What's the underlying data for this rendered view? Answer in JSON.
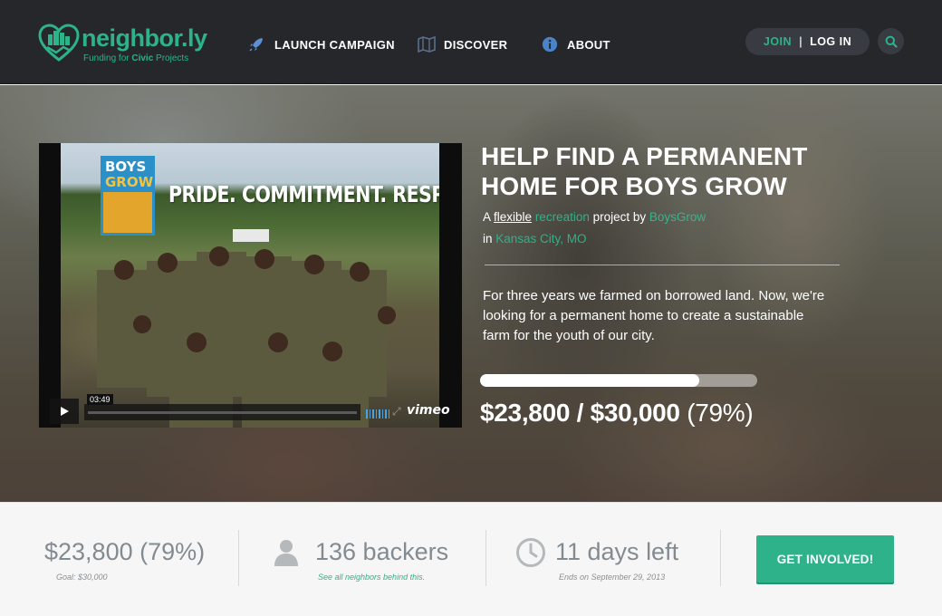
{
  "nav": {
    "logo_text": "neighbor.ly",
    "tagline_prefix": "Funding for ",
    "tagline_bold": "Civic",
    "tagline_suffix": " Projects",
    "items": [
      {
        "label": "LAUNCH CAMPAIGN",
        "icon": "rocket-icon"
      },
      {
        "label": "DISCOVER",
        "icon": "map-icon"
      },
      {
        "label": "ABOUT",
        "icon": "info-icon"
      }
    ],
    "join_label": "JOIN",
    "auth_separator": "|",
    "login_label": "LOG IN",
    "search_icon": "search-icon"
  },
  "video": {
    "badge_line1": "BOYS",
    "badge_line2": "GROW",
    "slogan": "PRIDE. COMMITMENT. RESPECT.",
    "time": "03:49",
    "provider": "vimeo"
  },
  "project": {
    "title": "HELP FIND A PERMANENT HOME FOR BOYS GROW",
    "byline_a": "A ",
    "funding_type": "flexible",
    "category": "recreation",
    "byline_project_by": " project by ",
    "owner": "BoysGrow",
    "byline_in": "in ",
    "location": "Kansas City, MO",
    "summary": "For three years we farmed on borrowed land. Now, we're looking for a permanent home to create a sustainable farm for the youth of our city.",
    "progress_fraction": 0.79,
    "pledged": "$23,800",
    "amount_sep": " / ",
    "goal": "$30,000",
    "percent": "(79%)"
  },
  "stats": {
    "pledged_text": "$23,800 (79%)",
    "goal_text": "Goal: $30,000",
    "backers_text": "136 backers",
    "backers_link": "See all neighbors behind this.",
    "days_text": "11 days left",
    "ends_text": "Ends on September 29, 2013",
    "cta_label": "GET INVOLVED!"
  },
  "colors": {
    "brand_green": "#2db289",
    "nav_bg": "#25272b",
    "stat_text": "#838b91"
  }
}
